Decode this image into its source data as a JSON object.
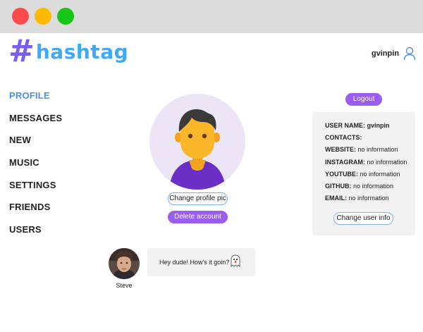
{
  "window": {
    "controls": [
      "close",
      "minimize",
      "maximize"
    ]
  },
  "brand": {
    "hash": "#",
    "name": "hashtag"
  },
  "header": {
    "username": "gvinpin",
    "user_icon": "user-icon"
  },
  "nav": {
    "items": [
      {
        "label": "PROFILE",
        "active": true
      },
      {
        "label": "MESSAGES",
        "active": false
      },
      {
        "label": "NEW",
        "active": false
      },
      {
        "label": "MUSIC",
        "active": false
      },
      {
        "label": "SETTINGS",
        "active": false
      },
      {
        "label": "FRIENDS",
        "active": false
      },
      {
        "label": "USERS",
        "active": false
      }
    ]
  },
  "profile": {
    "avatar_icon": "default-avatar",
    "change_pic_label": "Change profile pic",
    "delete_label": "Delete account"
  },
  "account": {
    "logout_label": "Logout",
    "username_label": "USER NAME:",
    "username_value": "gvinpin",
    "contacts_label": "CONTACTS:",
    "contacts": [
      {
        "label": "WEBSITE:",
        "value": "no information"
      },
      {
        "label": "INSTAGRAM:",
        "value": "no information"
      },
      {
        "label": "YOUTUBE:",
        "value": "no information"
      },
      {
        "label": "GITHUB:",
        "value": "no information"
      },
      {
        "label": "EMAIL:",
        "value": "no information"
      }
    ],
    "change_info_label": "Change user info"
  },
  "post": {
    "author": "Steve",
    "text": "Hey dude! How's it goin?",
    "emoji": "ghost-emoji"
  },
  "colors": {
    "accent_purple": "#9b5cf0",
    "nav_active": "#4a90e2",
    "card_bg": "#f2f2f2",
    "outline_blue": "#7fb0e8"
  }
}
